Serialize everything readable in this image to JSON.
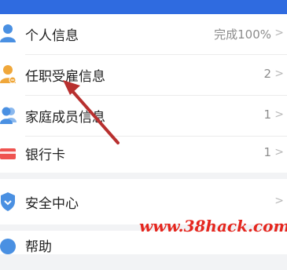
{
  "menu": {
    "rows": [
      {
        "label": "个人信息",
        "value": "完成100%",
        "chevron": ">",
        "icon": "person-icon",
        "icon_color": "#4a90e2"
      },
      {
        "label": "任职受雇信息",
        "value": "2",
        "chevron": ">",
        "icon": "employee-icon",
        "icon_color": "#f0a73a"
      },
      {
        "label": "家庭成员信息",
        "value": "1",
        "chevron": ">",
        "icon": "family-icon",
        "icon_color": "#4a90e2"
      },
      {
        "label": "银行卡",
        "value": "1",
        "chevron": ">",
        "icon": "bank-card-icon",
        "icon_color": "#ef5350"
      }
    ],
    "security": {
      "label": "安全中心",
      "chevron": ">",
      "icon": "shield-icon",
      "icon_color": "#4a90e2"
    },
    "help": {
      "label": "帮助",
      "icon": "help-icon",
      "icon_color": "#4a90e2"
    }
  },
  "watermark": "www.38hack.com",
  "annotation": {
    "color": "#b8302f"
  }
}
